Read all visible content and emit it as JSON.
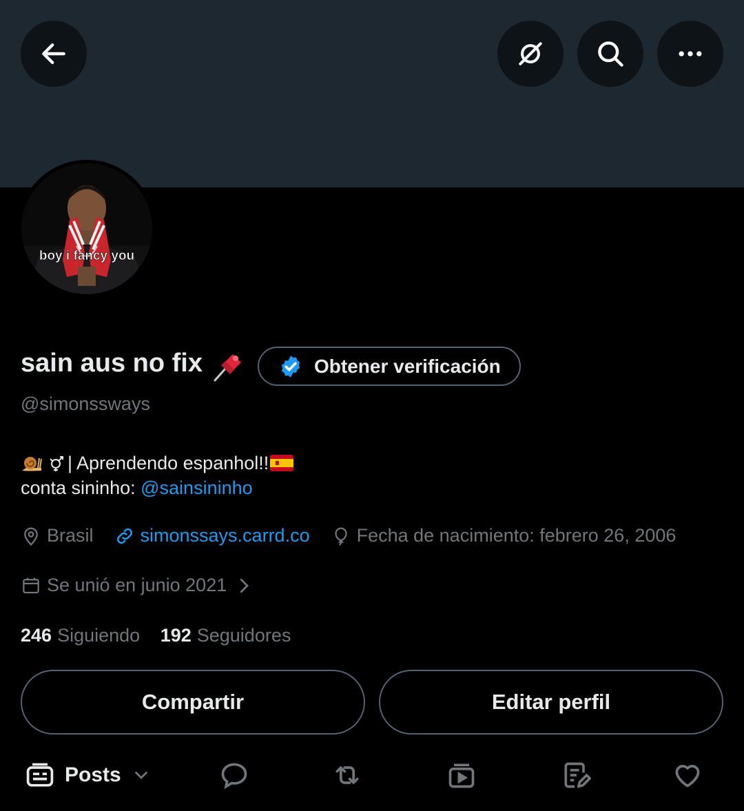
{
  "header": {
    "back_icon": "arrow-left-icon",
    "grok_icon": "grok-icon",
    "search_icon": "search-icon",
    "more_icon": "more-horizontal-icon",
    "banner_color": "#1e2831"
  },
  "profile": {
    "display_name": "sain aus no fix",
    "name_emoji": "pushpin-emoji",
    "verify_button_label": "Obtener verificación",
    "handle": "@simonssways",
    "bio_line1_text": " | Aprendendo espanhol!!",
    "bio_line2_text": "conta sininho: ",
    "bio_mention": "@sainsininho",
    "location": "Brasil",
    "website": "simonssays.carrd.co",
    "birthday": "Fecha de nacimiento: febrero 26, 2006",
    "joined": "Se unió en junio 2021",
    "following_count": "246",
    "following_label": "Siguiendo",
    "followers_count": "192",
    "followers_label": "Seguidores",
    "avatar_caption": "boy i fancy you"
  },
  "actions": {
    "share_label": "Compartir",
    "edit_label": "Editar perfil"
  },
  "tabs": {
    "posts_label": "Posts",
    "icons": [
      "posts-icon",
      "replies-icon",
      "reposts-icon",
      "media-icon",
      "articles-icon",
      "likes-icon"
    ]
  },
  "colors": {
    "accent": "#1d9bf0",
    "muted": "#71767b",
    "border": "#536471",
    "background": "#000000"
  }
}
